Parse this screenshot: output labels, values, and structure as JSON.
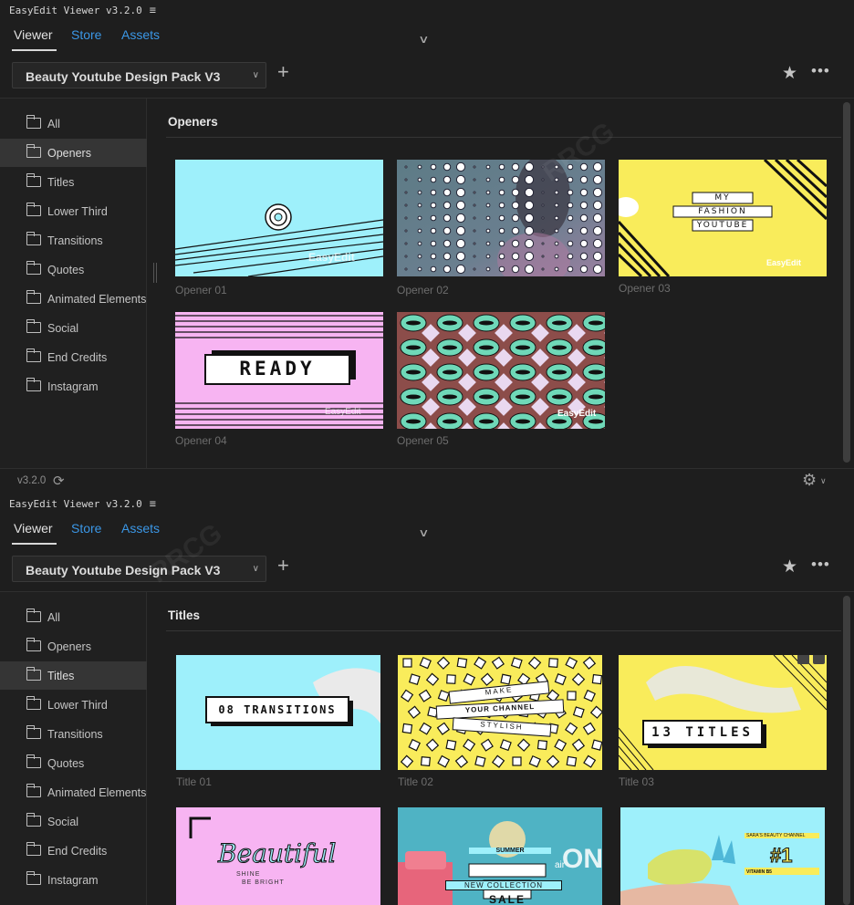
{
  "app": {
    "title": "EasyEdit Viewer v3.2.0",
    "menu_icon": "≡"
  },
  "tabs": [
    {
      "label": "Viewer",
      "active": true
    },
    {
      "label": "Store",
      "active": false
    },
    {
      "label": "Assets",
      "active": false
    }
  ],
  "toolbar": {
    "pack_name": "Beauty Youtube Design Pack V3",
    "add": "+",
    "star": "★",
    "more": "•••"
  },
  "sidebar": [
    "All",
    "Openers",
    "Titles",
    "Lower Third",
    "Transitions",
    "Quotes",
    "Animated Elements",
    "Social",
    "End Credits",
    "Instagram"
  ],
  "panel1": {
    "selected": "Openers",
    "heading": "Openers",
    "items": [
      {
        "label": "Opener 01",
        "thumb_text": "EasyEdit"
      },
      {
        "label": "Opener 02"
      },
      {
        "label": "Opener 03",
        "thumb_lines": [
          "MY",
          "FASHION",
          "YOUTUBE"
        ],
        "thumb_text": "EasyEdit"
      },
      {
        "label": "Opener 04",
        "thumb_text": "READY",
        "thumb_sub": "EasyEdit"
      },
      {
        "label": "Opener 05",
        "thumb_text": "EasyEdit"
      }
    ]
  },
  "statusbar": {
    "version": "v3.2.0",
    "refresh_icon": "⟳",
    "settings_icon": "⚙"
  },
  "panel2": {
    "selected": "Titles",
    "heading": "Titles",
    "items": [
      {
        "label": "Title 01",
        "thumb_text": "08 TRANSITIONS"
      },
      {
        "label": "Title 02",
        "thumb_lines": [
          "MAKE",
          "YOUR CHANNEL",
          "STYLISH"
        ]
      },
      {
        "label": "Title 03",
        "thumb_text": "13 TITLES"
      },
      {
        "label": "",
        "thumb_text": "Beautiful",
        "thumb_lines": [
          "SHINE",
          "BE BRIGHT"
        ]
      },
      {
        "label": "",
        "thumb_lines": [
          "SUMMER",
          "NEW COLLECTION",
          "SALE"
        ],
        "thumb_text": "ON",
        "thumb_small": "air"
      },
      {
        "label": "",
        "thumb_text": "#1",
        "thumb_lines": [
          "SARA'S BEAUTY CHANNEL",
          "VITAMIN B5"
        ]
      }
    ]
  },
  "colors": {
    "accent": "#3b97e6",
    "bg": "#1e1e1e",
    "selected": "#353535",
    "cyan": "#9ef0fb",
    "yellow": "#f9ec5b",
    "pink": "#f7b4f2"
  }
}
